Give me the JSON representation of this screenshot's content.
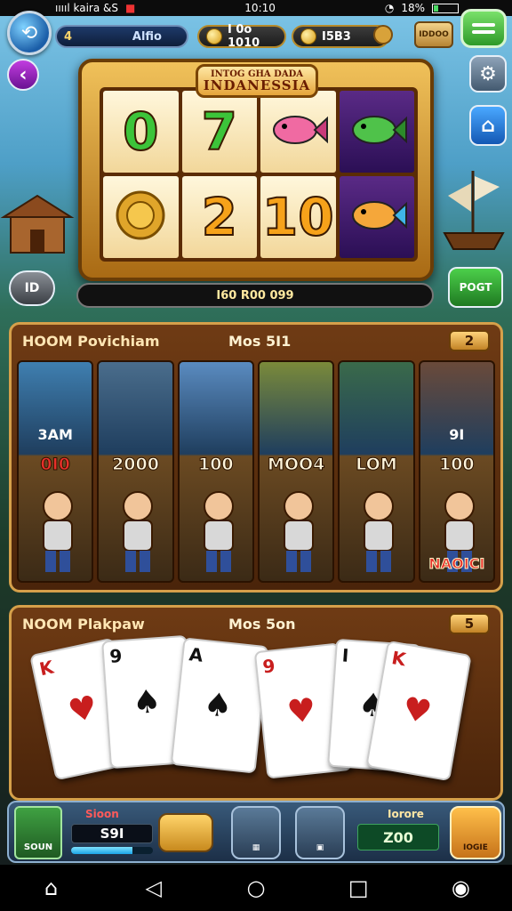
{
  "status_bar": {
    "left_text": "ııııl kaira &S",
    "time": "10:10",
    "battery": "18%",
    "battery_level": 0.18
  },
  "hud": {
    "level_number": "4",
    "level_name": "Alfio",
    "coin_text": "I 0o 1010",
    "gem_text": "I5B3",
    "shop_badge": "IDDOO"
  },
  "slot_machine": {
    "title_line1": "INTOG GHA DADA",
    "title_line2": "INDANESSIA",
    "reels": [
      {
        "type": "number",
        "text": "0",
        "color": "green"
      },
      {
        "type": "number",
        "text": "7",
        "color": "green"
      },
      {
        "type": "icon",
        "icon": "pink-fish-icon"
      },
      {
        "type": "icon",
        "icon": "green-fish-icon"
      },
      {
        "type": "icon",
        "icon": "gold-coin-icon"
      },
      {
        "type": "number",
        "text": "2",
        "color": "orange"
      },
      {
        "type": "number",
        "text": "10",
        "color": "orange"
      },
      {
        "type": "icon",
        "icon": "rainbow-fish-icon"
      }
    ],
    "readout": "I60 R00 099"
  },
  "side_buttons": {
    "left_round": "ID",
    "right_green": "POGT"
  },
  "panel_one": {
    "title": "HOOM Povichiam",
    "middle": "Mos 5I1",
    "badge": "2",
    "cards": [
      {
        "top": "3AM",
        "mid": "0I0",
        "mid_color": "red",
        "bottom": ""
      },
      {
        "top": "",
        "mid": "2000",
        "mid_color": "white",
        "bottom": ""
      },
      {
        "top": "",
        "mid": "100",
        "mid_color": "white",
        "bottom": ""
      },
      {
        "top": "",
        "mid": "MOO4",
        "mid_color": "white",
        "bottom": ""
      },
      {
        "top": "",
        "mid": "LOM",
        "mid_color": "white",
        "bottom": ""
      },
      {
        "top": "9I",
        "mid": "100",
        "mid_color": "white",
        "bottom": "NAOICI"
      }
    ]
  },
  "panel_two": {
    "title": "NOOM Plakpaw",
    "middle": "Mos 5on",
    "badge": "5",
    "cards": [
      {
        "rank": "K",
        "color": "red"
      },
      {
        "rank": "9",
        "color": "black"
      },
      {
        "rank": "A",
        "color": "black"
      },
      {
        "rank": "9",
        "color": "red"
      },
      {
        "rank": "I",
        "color": "black"
      },
      {
        "rank": "K",
        "color": "red"
      }
    ]
  },
  "bottom_hud": {
    "stage_label": "SOUN",
    "xp_label": "Sioon",
    "xp_value": "S9I",
    "xp_progress": 0.75,
    "tool1_label": "",
    "tool2_label": "",
    "win_label": "Iorore",
    "win_value": "Z00",
    "action_label": "IOGIE"
  }
}
